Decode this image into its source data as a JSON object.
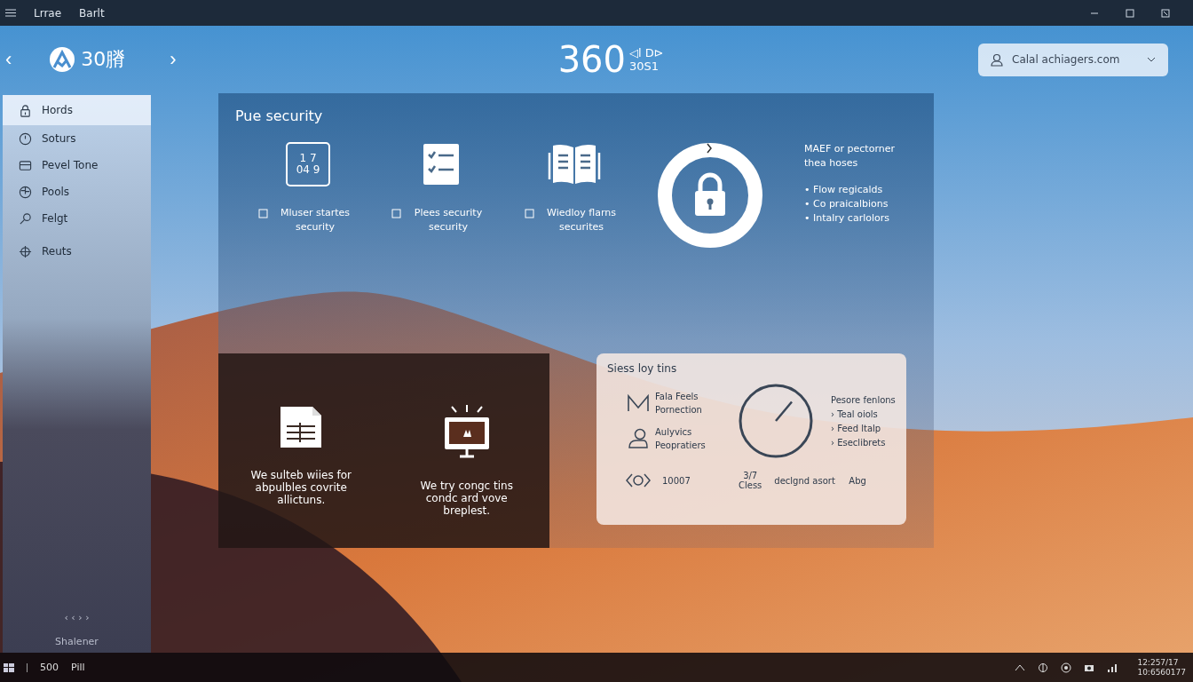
{
  "window": {
    "title_left": "Lrrae",
    "title_right": "Barlt"
  },
  "header": {
    "logo_text": "30膌",
    "nav_prev": "‹",
    "nav_next": "›",
    "big_number": "360",
    "small_top": "◁l D⊳",
    "small_bottom": "30S1",
    "account": "Calal achiagers.com"
  },
  "sidebar": {
    "items": [
      {
        "label": "Hords",
        "selected": true
      },
      {
        "label": "Soturs",
        "selected": false
      },
      {
        "label": "Pevel Tone",
        "selected": false
      },
      {
        "label": "Pools",
        "selected": false
      },
      {
        "label": "Felgt",
        "selected": false
      },
      {
        "label": "Reuts",
        "selected": false
      }
    ],
    "pager": "‹ ‹ › ›",
    "footer": "Shalener"
  },
  "security": {
    "title": "Pue security",
    "features": [
      {
        "icon_top": "1 7",
        "icon_bottom": "04 9",
        "label": "Mluser startes security"
      },
      {
        "label": "Plees security security"
      },
      {
        "label": "Wiedloy flarns securites"
      }
    ],
    "lock_caption": "MAEF or pectorner thea hoses",
    "bullets": [
      "• Flow regicalds",
      "• Co praicalbions",
      "• Intalry carlolors"
    ]
  },
  "dark_card": {
    "items": [
      {
        "text": "We sulteb wiies for abpulbles covrite allictuns."
      },
      {
        "text": "We try congc tins condc ard vove breplest."
      }
    ]
  },
  "status_card": {
    "title": "Siess loy tins",
    "rows": [
      {
        "text": "Fala Feels Pornection"
      },
      {
        "text": "Aulyvics Peopratiers"
      }
    ],
    "list_title": "Pesore fenlons",
    "list": [
      "› Teal oiols",
      "› Feed ltalp",
      "› Eseclibrets"
    ],
    "footer": {
      "code": "10007",
      "ratio": "3/7",
      "ratio_label": "Cless",
      "tag": "declgnd asort",
      "end": "Abg"
    }
  },
  "taskbar": {
    "left_a": "500",
    "left_b": "Pill",
    "clock_top": "12:257/17",
    "clock_bottom": "10:6560177"
  }
}
